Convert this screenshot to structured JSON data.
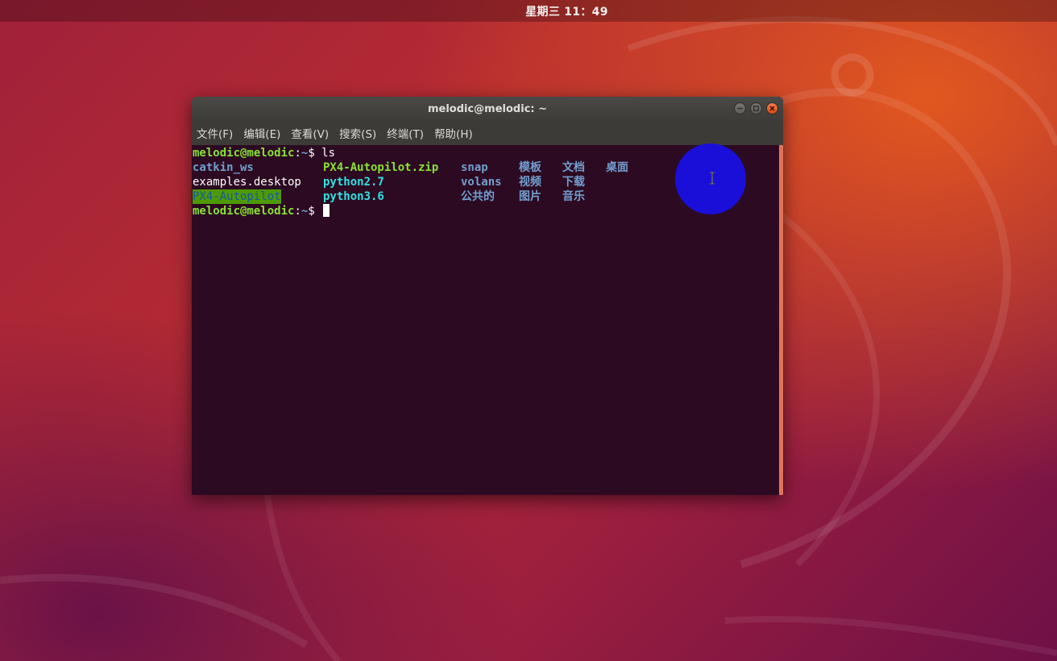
{
  "topbar": {
    "clock": "星期三 11：49"
  },
  "window": {
    "title": "melodic@melodic: ~",
    "buttons": {
      "minimize": "minimize-icon",
      "maximize": "maximize-icon",
      "close": "close-icon"
    },
    "menu": [
      "文件(F)",
      "编辑(E)",
      "查看(V)",
      "搜索(S)",
      "终端(T)",
      "帮助(H)"
    ]
  },
  "terminal": {
    "line1": {
      "user_host": "melodic@melodic",
      "sep": ":",
      "path": "~",
      "dollar": "$ ",
      "command": "ls"
    },
    "listing": {
      "row1": [
        "catkin_ws",
        "PX4-Autopilot.zip",
        "snap",
        "模板",
        "文档",
        "桌面"
      ],
      "row2": [
        "examples.desktop",
        "python2.7",
        "volans",
        "视频",
        "下载"
      ],
      "row3": [
        "PX4-Autopilot",
        "python3.6",
        "公共的",
        "图片",
        "音乐"
      ]
    },
    "line5": {
      "user_host": "melodic@melodic",
      "sep": ":",
      "path": "~",
      "dollar": "$ "
    }
  },
  "colors": {
    "prompt": "#8ae234",
    "directory": "#729fcf",
    "archive": "#8ae234",
    "symlink": "#34e2e2",
    "terminal_bg": "#2c0a22",
    "click_indicator": "#1a0fd8"
  }
}
